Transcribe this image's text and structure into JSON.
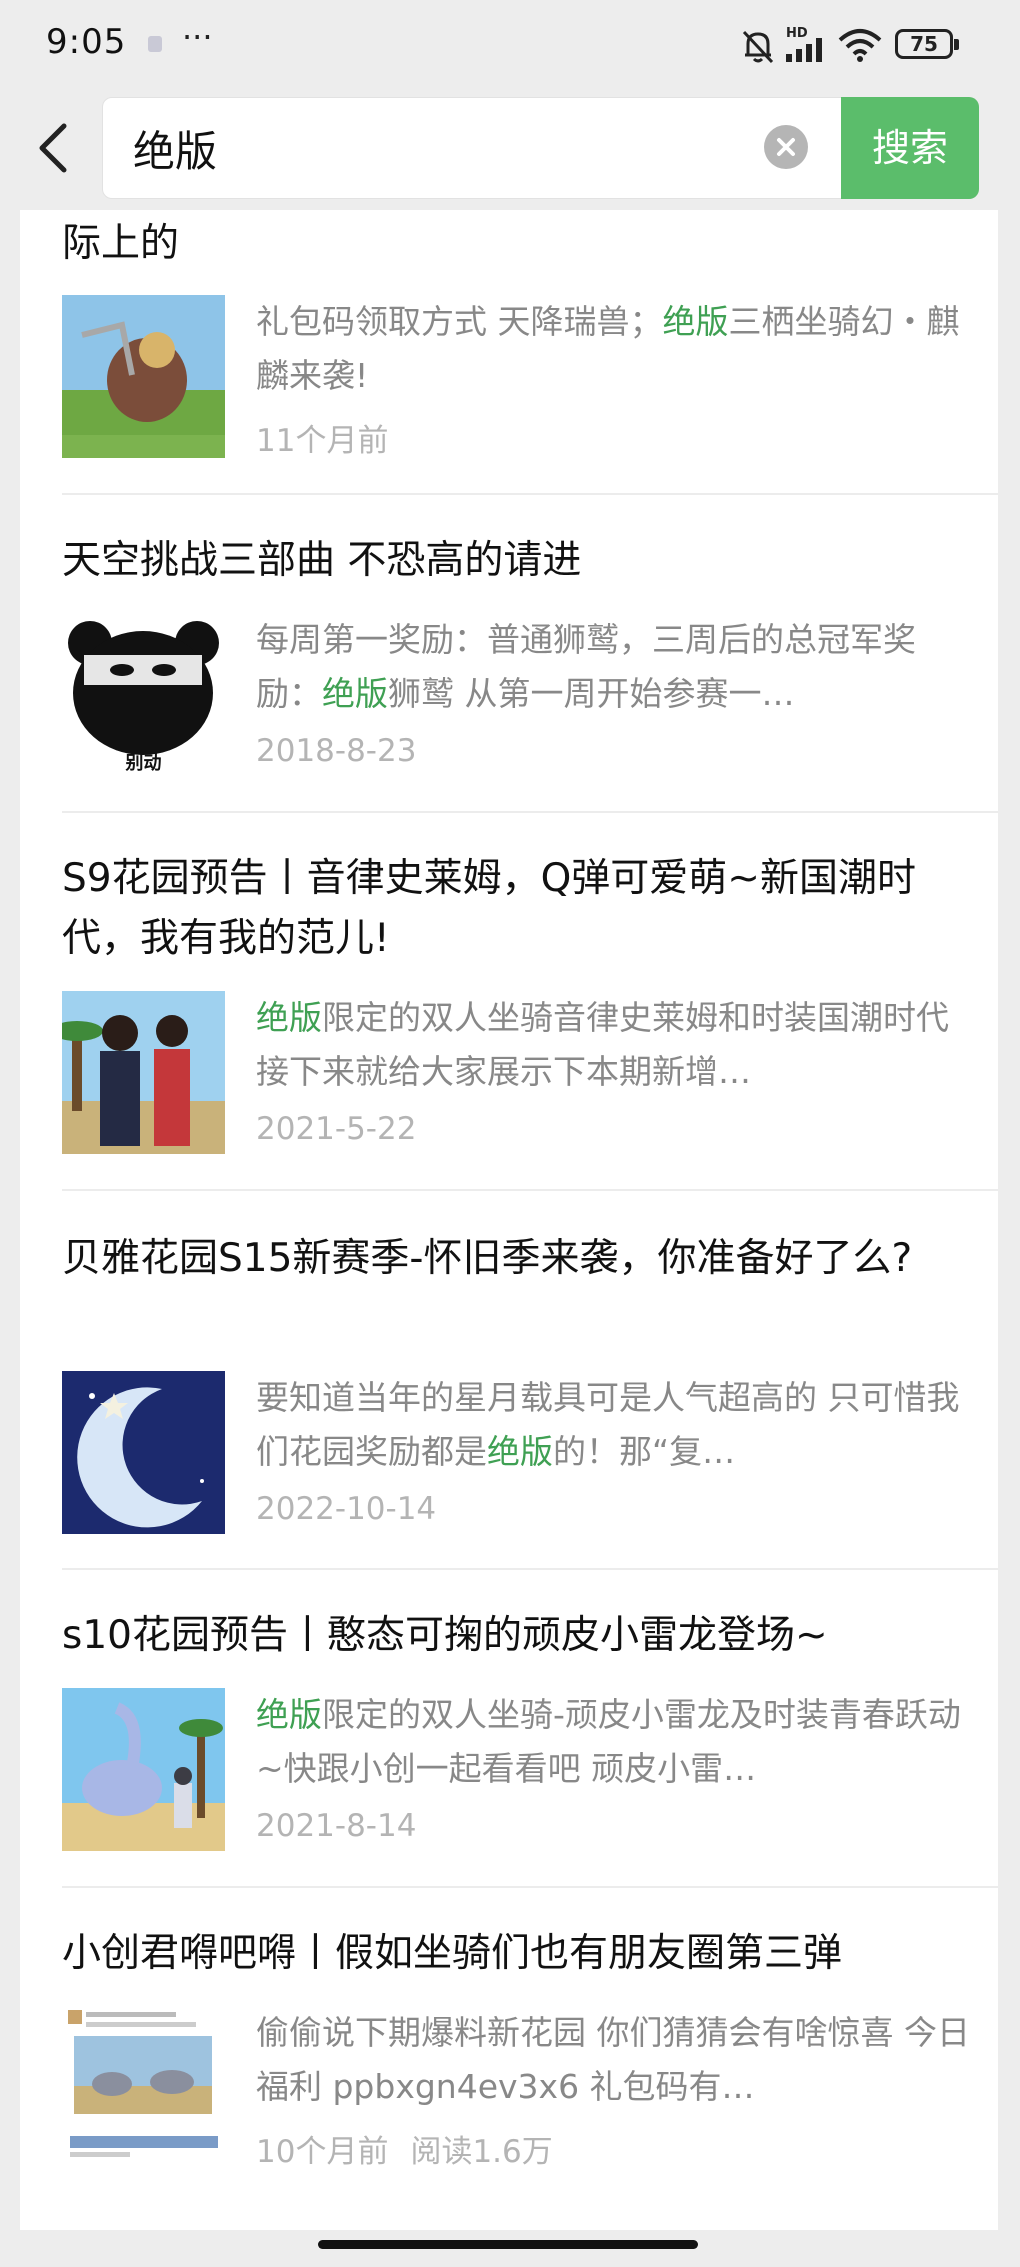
{
  "status_bar": {
    "time": "9:05",
    "more": "···",
    "network": "HD",
    "battery": "75",
    "icons": [
      "bell-off-icon",
      "signal-icon",
      "wifi-icon",
      "battery-icon"
    ]
  },
  "search": {
    "query": "绝版",
    "button_label": "搜索",
    "accent_color": "#5bbd6b",
    "highlight_color": "#3fa053"
  },
  "results": [
    {
      "title": "际上的",
      "snippet_pre": "礼包码领取方式 天降瑞兽；",
      "snippet_hl": "绝版",
      "snippet_post": "三栖坐骑幻・麒麟来袭!",
      "date": "11个月前",
      "reads": ""
    },
    {
      "title": "天空挑战三部曲 不恐高的请进",
      "snippet_pre": "每周第一奖励：普通狮鹫，三周后的总冠军奖励：",
      "snippet_hl": "绝版",
      "snippet_post": "狮鹫 从第一周开始参赛一…",
      "date": "2018-8-23",
      "reads": "",
      "thumb_caption": "别动"
    },
    {
      "title": "S9花园预告丨音律史莱姆，Q弹可爱萌~新国潮时代，我有我的范儿!",
      "snippet_pre": "",
      "snippet_hl": "绝版",
      "snippet_post": "限定的双人坐骑音律史莱姆和时装国潮时代 接下来就给大家展示下本期新增…",
      "date": "2021-5-22",
      "reads": ""
    },
    {
      "title": "贝雅花园S15新赛季-怀旧季来袭，你准备好了么?",
      "snippet_pre": "要知道当年的星月载具可是人气超高的 只可惜我们花园奖励都是",
      "snippet_hl": "绝版",
      "snippet_post": "的！那“复…",
      "date": "2022-10-14",
      "reads": ""
    },
    {
      "title": "s10花园预告丨憨态可掬的顽皮小雷龙登场~",
      "snippet_pre": "",
      "snippet_hl": "绝版",
      "snippet_post": "限定的双人坐骑-顽皮小雷龙及时装青春跃动~快跟小创一起看看吧 顽皮小雷…",
      "date": "2021-8-14",
      "reads": ""
    },
    {
      "title": "小创君嘚吧嘚丨假如坐骑们也有朋友圈第三弹",
      "snippet_pre": "偷偷说下期爆料新花园 你们猜猜会有啥惊喜 今日福利 ppbxgn4ev3x6 礼包码有…",
      "snippet_hl": "",
      "snippet_post": "",
      "date": "10个月前",
      "reads": "阅读1.6万"
    }
  ]
}
